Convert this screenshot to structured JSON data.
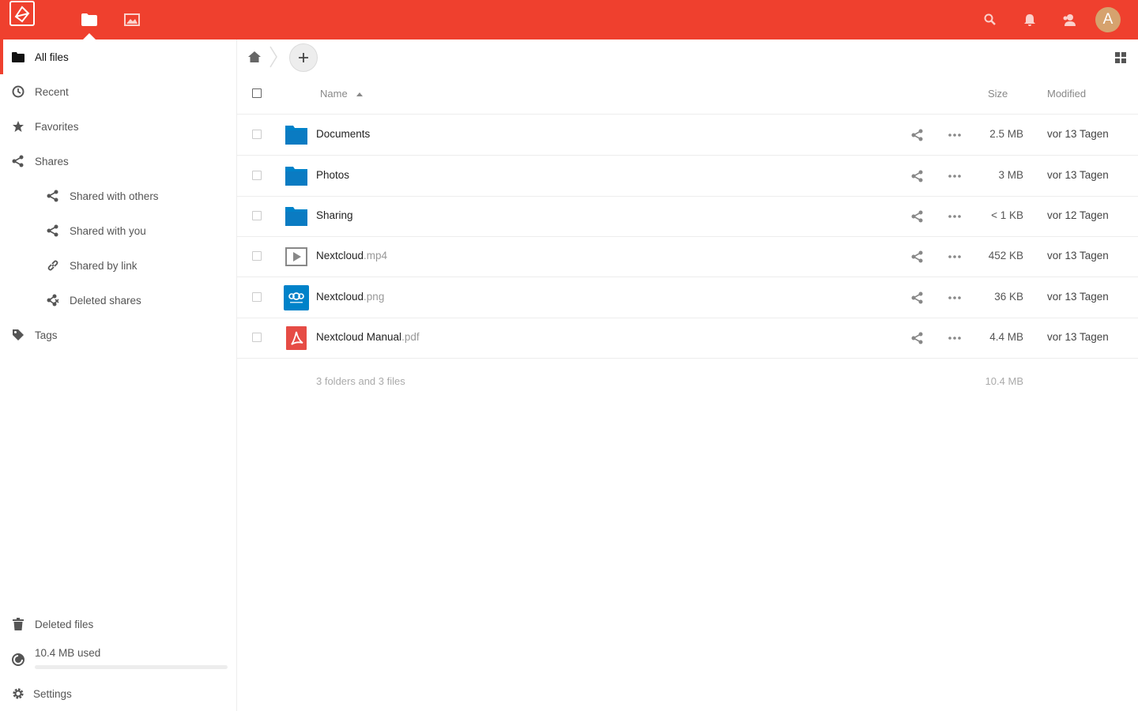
{
  "header": {
    "apps": [
      {
        "name": "files-app",
        "icon": "folder-icon",
        "active": true
      },
      {
        "name": "gallery-app",
        "icon": "image-icon",
        "active": false
      }
    ],
    "avatar_letter": "A",
    "brand_color": "#ef402e",
    "avatar_color": "#d6a26e"
  },
  "sidebar": {
    "items": [
      {
        "label": "All files",
        "icon": "folder-icon",
        "active": true
      },
      {
        "label": "Recent",
        "icon": "clock-icon"
      },
      {
        "label": "Favorites",
        "icon": "star-icon"
      },
      {
        "label": "Shares",
        "icon": "share-icon"
      },
      {
        "label": "Shared with others",
        "icon": "share-icon"
      },
      {
        "label": "Shared with you",
        "icon": "share-icon"
      },
      {
        "label": "Shared by link",
        "icon": "link-icon"
      },
      {
        "label": "Deleted shares",
        "icon": "deleted-share-icon"
      },
      {
        "label": "Tags",
        "icon": "tag-icon"
      }
    ],
    "deleted_files": "Deleted files",
    "quota_label": "10.4 MB used",
    "quota_fraction": 0.0,
    "settings": "Settings"
  },
  "table": {
    "columns": {
      "name": "Name",
      "size": "Size",
      "modified": "Modified"
    },
    "rows": [
      {
        "base": "Documents",
        "ext": "",
        "type": "folder",
        "size": "2.5 MB",
        "modified": "vor 13 Tagen"
      },
      {
        "base": "Photos",
        "ext": "",
        "type": "folder",
        "size": "3 MB",
        "modified": "vor 13 Tagen"
      },
      {
        "base": "Sharing",
        "ext": "",
        "type": "folder",
        "size": "< 1 KB",
        "modified": "vor 12 Tagen"
      },
      {
        "base": "Nextcloud",
        "ext": ".mp4",
        "type": "video",
        "size": "452 KB",
        "modified": "vor 13 Tagen"
      },
      {
        "base": "Nextcloud",
        "ext": ".png",
        "type": "image",
        "size": "36 KB",
        "modified": "vor 13 Tagen"
      },
      {
        "base": "Nextcloud Manual",
        "ext": ".pdf",
        "type": "pdf",
        "size": "4.4 MB",
        "modified": "vor 13 Tagen"
      }
    ],
    "summary": "3 folders and 3 files",
    "summary_size": "10.4 MB"
  }
}
